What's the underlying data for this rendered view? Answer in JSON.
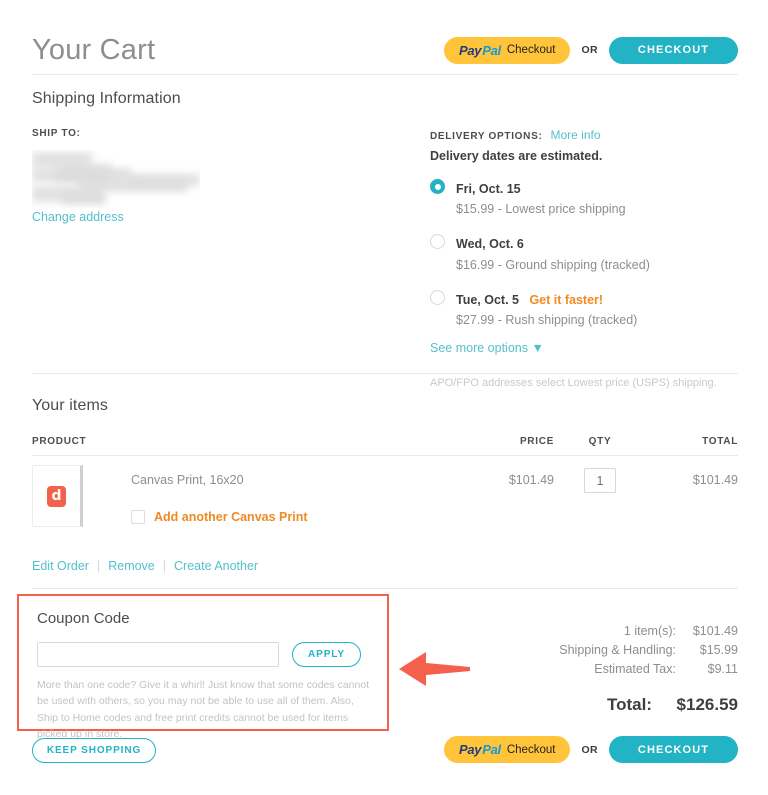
{
  "header": {
    "title": "Your Cart",
    "paypal_pay": "Pay",
    "paypal_pal": "Pal",
    "paypal_checkout": "Checkout",
    "or": "OR",
    "checkout": "CHECKOUT"
  },
  "shipping": {
    "section_title": "Shipping Information",
    "ship_to_label": "SHIP TO:",
    "change_address": "Change address",
    "delivery_options_label": "DELIVERY OPTIONS:",
    "more_info": "More info",
    "estimated_note": "Delivery dates are estimated.",
    "options": [
      {
        "date": "Fri, Oct. 15",
        "badge": "",
        "desc": "$15.99 - Lowest price shipping",
        "selected": true
      },
      {
        "date": "Wed, Oct. 6",
        "badge": "",
        "desc": "$16.99 - Ground shipping (tracked)",
        "selected": false
      },
      {
        "date": "Tue, Oct. 5",
        "badge": "Get it faster!",
        "desc": "$27.99 - Rush shipping (tracked)",
        "selected": false
      }
    ],
    "see_more": "See more options ▼",
    "apo_note": "APO/FPO addresses select Lowest price (USPS) shipping."
  },
  "items": {
    "section_title": "Your items",
    "columns": {
      "product": "PRODUCT",
      "price": "PRICE",
      "qty": "QTY",
      "total": "TOTAL"
    },
    "rows": [
      {
        "thumb_glyph": "d",
        "name": "Canvas Print, 16x20",
        "add_another": "Add another Canvas Print",
        "price": "$101.49",
        "qty": "1",
        "total": "$101.49"
      }
    ],
    "links": {
      "edit": "Edit Order",
      "sep": "|",
      "remove": "Remove",
      "create": "Create Another"
    }
  },
  "coupon": {
    "title": "Coupon Code",
    "input_value": "",
    "input_placeholder": "",
    "apply": "APPLY",
    "fine_print": "More than one code? Give it a whirl! Just know that some codes cannot be used with others, so you may not be able to use all of them. Also, Ship to Home codes and free print credits cannot be used for items picked up in store."
  },
  "totals": {
    "lines": [
      {
        "label": "1 item(s):",
        "value": "$101.49"
      },
      {
        "label": "Shipping & Handling:",
        "value": "$15.99"
      },
      {
        "label": "Estimated Tax:",
        "value": "$9.11"
      }
    ],
    "grand_label": "Total:",
    "grand_value": "$126.59"
  },
  "footer": {
    "keep_shopping": "KEEP SHOPPING",
    "paypal_pay": "Pay",
    "paypal_pal": "Pal",
    "paypal_checkout": "Checkout",
    "or": "OR",
    "checkout": "CHECKOUT"
  },
  "colors": {
    "teal": "#22b3c4",
    "link_teal": "#52c0cc",
    "orange": "#f08a24",
    "annotation_red": "#f4604b",
    "paypal_yellow": "#ffc43a"
  }
}
